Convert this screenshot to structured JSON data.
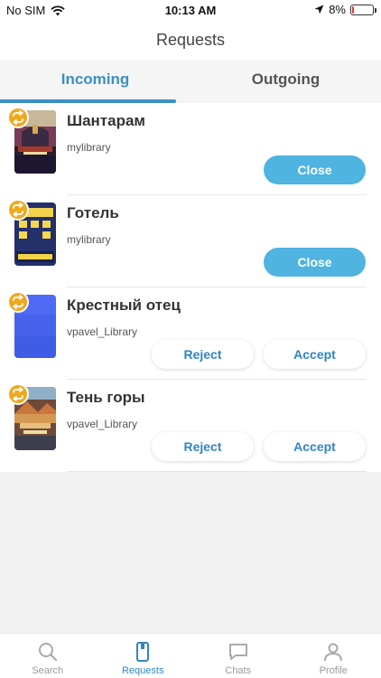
{
  "status_bar": {
    "carrier": "No SIM",
    "time": "10:13 AM",
    "battery": "8%",
    "battery_level": 0.08
  },
  "header": {
    "title": "Requests"
  },
  "tabs": [
    {
      "label": "Incoming",
      "active": true
    },
    {
      "label": "Outgoing",
      "active": false
    }
  ],
  "requests": [
    {
      "title": "Шантарам",
      "owner": "mylibrary",
      "action": "Close"
    },
    {
      "title": "Готель",
      "owner": "mylibrary",
      "action": "Close"
    },
    {
      "title": "Крестный отец",
      "owner": "vpavel_Library",
      "reject": "Reject",
      "accept": "Accept"
    },
    {
      "title": "Тень горы",
      "owner": "vpavel_Library",
      "reject": "Reject",
      "accept": "Accept"
    }
  ],
  "tabbar": [
    {
      "label": "Search",
      "icon": "search-icon",
      "active": false
    },
    {
      "label": "Requests",
      "icon": "requests-icon",
      "active": true
    },
    {
      "label": "Chats",
      "icon": "chat-icon",
      "active": false
    },
    {
      "label": "Profile",
      "icon": "profile-icon",
      "active": false
    }
  ],
  "colors": {
    "accent": "#3b8fc2",
    "button": "#4fb4df",
    "badge": "#f0a81e"
  }
}
